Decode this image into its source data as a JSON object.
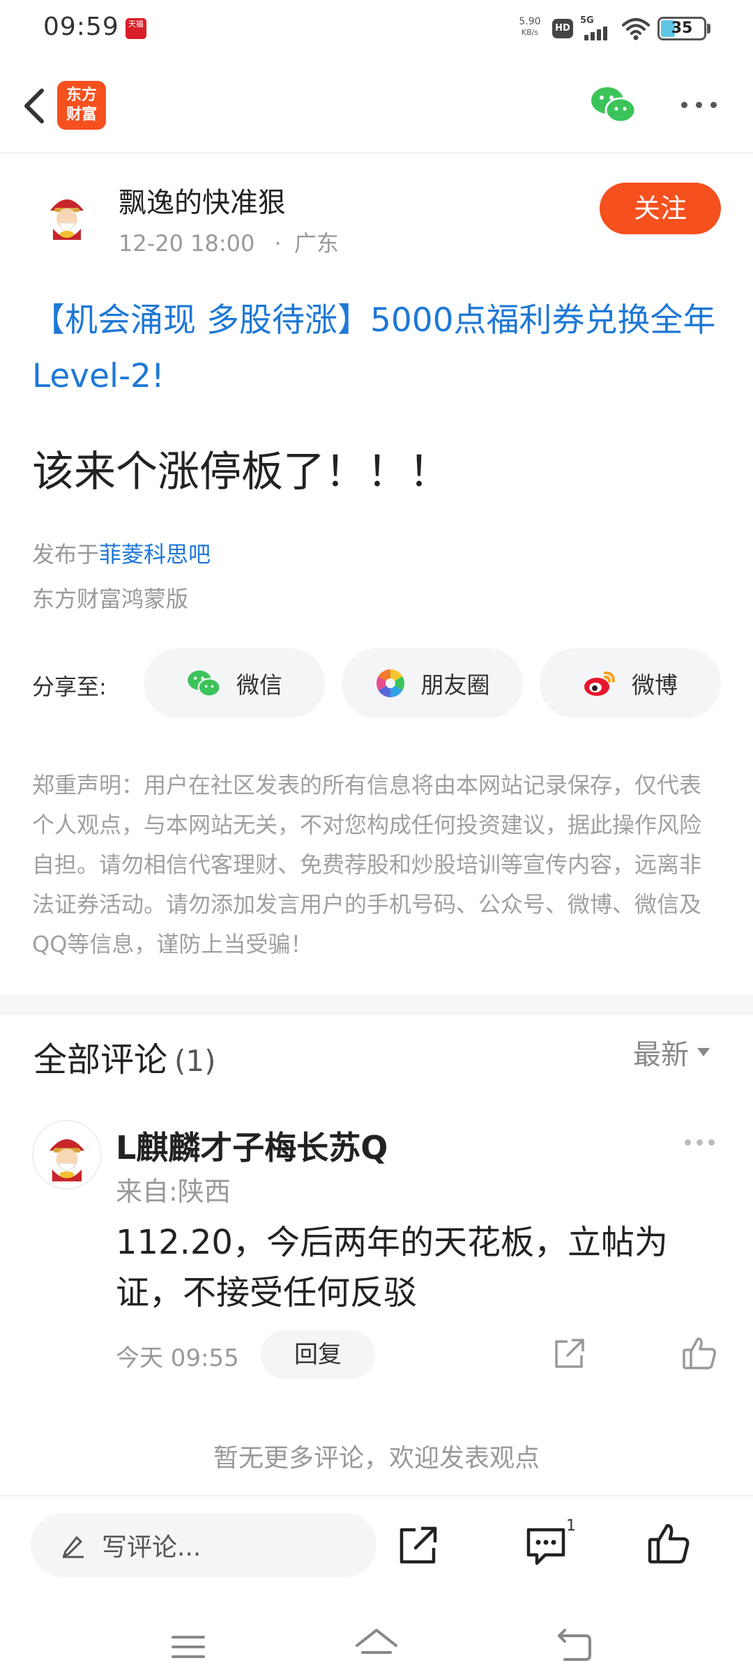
{
  "status_bar": {
    "time": "09:59",
    "tmall_badge": "天猫",
    "net_speed_value": "5.90",
    "net_speed_unit": "KB/s",
    "hd_label": "HD",
    "network_type": "5G",
    "battery_level": "35"
  },
  "nav": {
    "logo_line1": "东方",
    "logo_line2": "财富",
    "icons": [
      "back-icon",
      "wechat-icon",
      "more-icon"
    ]
  },
  "post": {
    "author": "飘逸的快准狠",
    "datetime": "12-20 18:00",
    "location": "广东",
    "follow_label": "关注",
    "promo_title": "【机会涌现 多股待涨】5000点福利券兑换全年Level-2!",
    "body": "该来个涨停板了！！！",
    "published_prefix": "发布于",
    "forum_name": "菲菱科思吧",
    "client": "东方财富鸿蒙版"
  },
  "share": {
    "label": "分享至:",
    "wechat": "微信",
    "moments": "朋友圈",
    "weibo": "微博"
  },
  "disclaimer": "郑重声明：用户在社区发表的所有信息将由本网站记录保存，仅代表个人观点，与本网站无关，不对您构成任何投资建议，据此操作风险自担。请勿相信代客理财、免费荐股和炒股培训等宣传内容，远离非法证券活动。请勿添加发言用户的手机号码、公众号、微博、微信及QQ等信息，谨防上当受骗！",
  "comments": {
    "title": "全部评论",
    "count": "(1)",
    "sort_label": "最新",
    "items": [
      {
        "user": "L麒麟才子梅长苏Q",
        "location": "来自:陕西",
        "text": "112.20，今后两年的天花板，立帖为证，不接受任何反驳",
        "time": "今天 09:55",
        "reply_label": "回复"
      }
    ],
    "no_more": "暂无更多评论，欢迎发表观点"
  },
  "toolbar": {
    "input_placeholder": "写评论...",
    "comment_count": "1"
  },
  "colors": {
    "brand_orange": "#f5501e",
    "link_blue": "#1e78d6",
    "muted_text": "#999999"
  }
}
